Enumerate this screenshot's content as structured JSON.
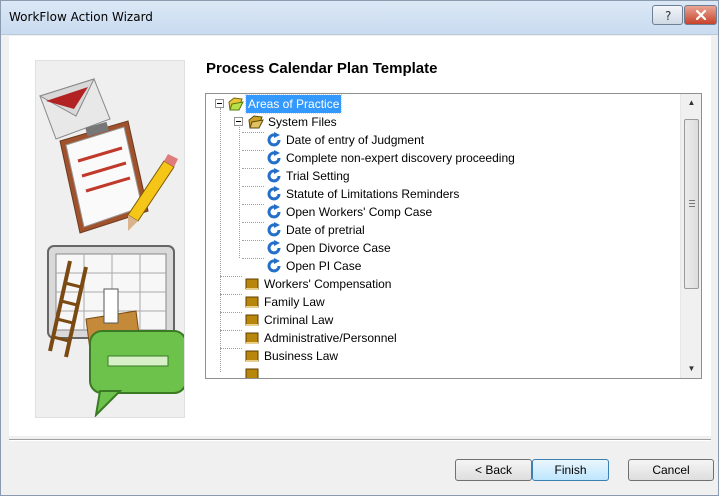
{
  "window": {
    "title": "WorkFlow Action Wizard",
    "help_label": "?",
    "close_label": "×"
  },
  "page": {
    "heading": "Process Calendar Plan Template"
  },
  "tree": {
    "root": "Areas of Practice",
    "system_files": "System Files",
    "items": [
      "Date of entry of Judgment",
      "Complete non-expert discovery proceeding",
      "Trial Setting",
      "Statute of Limitations Reminders",
      "Open Workers' Comp Case",
      "Date of pretrial",
      "Open Divorce Case",
      "Open PI Case"
    ],
    "folders": [
      "Workers' Compensation",
      "Family Law",
      "Criminal Law",
      "Administrative/Personnel",
      "Business Law"
    ]
  },
  "buttons": {
    "back": "< Back",
    "finish": "Finish",
    "cancel": "Cancel"
  },
  "colors": {
    "selection": "#3399ff",
    "cycle_icon": "#2470c9",
    "folder_icon": "#b8860b"
  }
}
